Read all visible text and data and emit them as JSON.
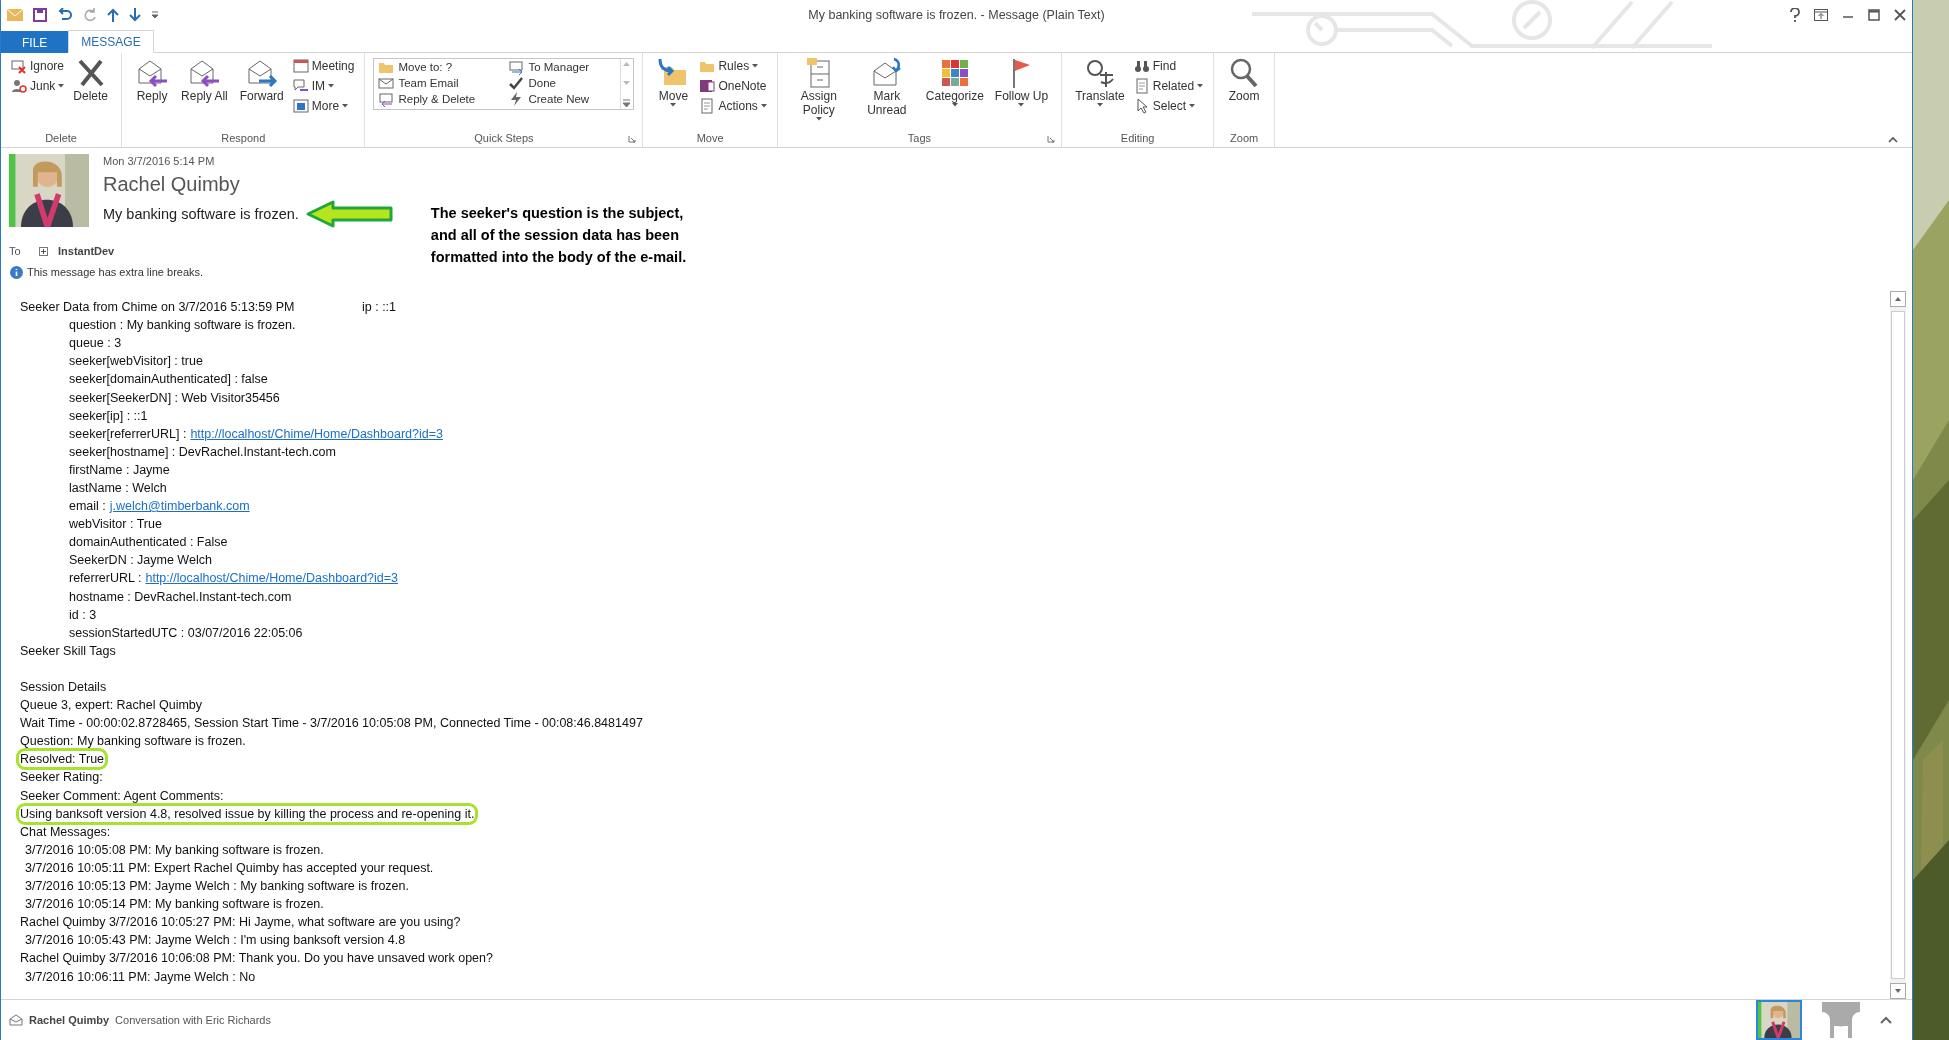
{
  "window": {
    "title": "My banking software is frozen. - Message (Plain Text)"
  },
  "ribbon_tabs": [
    {
      "label": "FILE",
      "kind": "file",
      "selected": false
    },
    {
      "label": "MESSAGE",
      "kind": "tab",
      "selected": true
    }
  ],
  "ribbon_groups": [
    {
      "label": "Delete",
      "launcher": false,
      "columns": [
        {
          "kind": "stack",
          "items": [
            {
              "label": "Ignore",
              "dropdown": false
            },
            {
              "label": "Junk",
              "dropdown": true
            }
          ]
        },
        {
          "kind": "large",
          "label": "Delete",
          "dropdown": false
        }
      ]
    },
    {
      "label": "Respond",
      "launcher": false,
      "columns": [
        {
          "kind": "large",
          "label": "Reply",
          "dropdown": false
        },
        {
          "kind": "large",
          "label": "Reply All",
          "dropdown": false
        },
        {
          "kind": "large",
          "label": "Forward",
          "dropdown": false
        },
        {
          "kind": "stack",
          "items": [
            {
              "label": "Meeting",
              "dropdown": false
            },
            {
              "label": "IM",
              "dropdown": true
            },
            {
              "label": "More",
              "dropdown": true
            }
          ]
        }
      ]
    },
    {
      "label": "Quick Steps",
      "launcher": true,
      "columns": [
        {
          "kind": "gallery",
          "items": [
            {
              "label": "Move to: ?"
            },
            {
              "label": "Team Email"
            },
            {
              "label": "Reply & Delete"
            },
            {
              "label": "To Manager"
            },
            {
              "label": "Done"
            },
            {
              "label": "Create New"
            }
          ]
        }
      ]
    },
    {
      "label": "Move",
      "launcher": false,
      "columns": [
        {
          "kind": "large",
          "label": "Move",
          "dropdown": true
        },
        {
          "kind": "stack",
          "items": [
            {
              "label": "Rules",
              "dropdown": true
            },
            {
              "label": "OneNote",
              "dropdown": false
            },
            {
              "label": "Actions",
              "dropdown": true
            }
          ]
        }
      ]
    },
    {
      "label": "Tags",
      "launcher": true,
      "columns": [
        {
          "kind": "large",
          "label": "Assign Policy",
          "dropdown": true
        },
        {
          "kind": "large",
          "label": "Mark Unread",
          "dropdown": false
        },
        {
          "kind": "large",
          "label": "Categorize",
          "dropdown": true
        },
        {
          "kind": "large",
          "label": "Follow Up",
          "dropdown": true
        }
      ]
    },
    {
      "label": "Editing",
      "launcher": false,
      "columns": [
        {
          "kind": "large",
          "label": "Translate",
          "dropdown": true
        },
        {
          "kind": "stack",
          "items": [
            {
              "label": "Find",
              "dropdown": false
            },
            {
              "label": "Related",
              "dropdown": true
            },
            {
              "label": "Select",
              "dropdown": true
            }
          ]
        }
      ]
    },
    {
      "label": "Zoom",
      "launcher": false,
      "columns": [
        {
          "kind": "large",
          "label": "Zoom",
          "dropdown": false
        }
      ]
    }
  ],
  "header": {
    "date": "Mon 3/7/2016 5:14 PM",
    "sender": "Rachel Quimby",
    "subject": "My banking software is frozen.",
    "to_label": "To",
    "recipient": "InstantDev",
    "info": "This message has extra line breaks."
  },
  "annotation": {
    "lines": [
      "The seeker's question is the subject,",
      "and all of the session data has been",
      "formatted into the body of the e-mail."
    ]
  },
  "body": [
    {
      "kind": "line",
      "text": "Seeker Data from Chime on 3/7/2016 5:13:59 PM",
      "aside": "ip : ::1",
      "highlighted": false
    },
    {
      "kind": "field",
      "text": "question : My banking software is frozen.",
      "highlighted": false
    },
    {
      "kind": "field",
      "text": "queue : 3",
      "highlighted": false
    },
    {
      "kind": "field",
      "text": "seeker[webVisitor] : true",
      "highlighted": false
    },
    {
      "kind": "field",
      "text": "seeker[domainAuthenticated] : false",
      "highlighted": false
    },
    {
      "kind": "field",
      "text": "seeker[SeekerDN] : Web Visitor35456",
      "highlighted": false
    },
    {
      "kind": "field",
      "text": "seeker[ip] : ::1",
      "highlighted": false
    },
    {
      "kind": "field",
      "text": "seeker[referrerURL] :",
      "link": "http://localhost/Chime/Home/Dashboard?id=3",
      "highlighted": false
    },
    {
      "kind": "field",
      "text": "seeker[hostname] : DevRachel.Instant-tech.com",
      "highlighted": false
    },
    {
      "kind": "field",
      "text": "firstName : Jayme",
      "highlighted": false
    },
    {
      "kind": "field",
      "text": "lastName : Welch",
      "highlighted": false
    },
    {
      "kind": "field",
      "text": "email :",
      "link": "j.welch@timberbank.com",
      "highlighted": false
    },
    {
      "kind": "field",
      "text": "webVisitor : True",
      "highlighted": false
    },
    {
      "kind": "field",
      "text": "domainAuthenticated : False",
      "highlighted": false
    },
    {
      "kind": "field",
      "text": "SeekerDN : Jayme Welch",
      "highlighted": false
    },
    {
      "kind": "field",
      "text": "referrerURL :",
      "link": "http://localhost/Chime/Home/Dashboard?id=3",
      "highlighted": false
    },
    {
      "kind": "field",
      "text": "hostname : DevRachel.Instant-tech.com",
      "highlighted": false
    },
    {
      "kind": "field",
      "text": "id : 3",
      "highlighted": false
    },
    {
      "kind": "field",
      "text": "sessionStartedUTC : 03/07/2016 22:05:06",
      "highlighted": false
    },
    {
      "kind": "line",
      "text": "Seeker Skill Tags",
      "highlighted": false
    },
    {
      "kind": "blank"
    },
    {
      "kind": "line",
      "text": "Session Details",
      "highlighted": false
    },
    {
      "kind": "line",
      "text": "Queue 3, expert: Rachel Quimby",
      "highlighted": false
    },
    {
      "kind": "line",
      "text": "Wait Time - 00:00:02.8728465, Session Start Time - 3/7/2016 10:05:08 PM, Connected Time - 00:08:46.8481497",
      "highlighted": false
    },
    {
      "kind": "line",
      "text": "Question: My banking software is frozen.",
      "highlighted": false
    },
    {
      "kind": "line",
      "text": "Resolved: True",
      "highlighted": true
    },
    {
      "kind": "line",
      "text": "Seeker Rating:",
      "highlighted": false
    },
    {
      "kind": "line",
      "text": "Seeker Comment: Agent Comments:",
      "highlighted": false
    },
    {
      "kind": "line",
      "text": "Using banksoft version 4.8, resolved issue by killing the process and re-opening it.",
      "highlighted": true
    },
    {
      "kind": "line",
      "text": "Chat Messages:",
      "highlighted": false
    },
    {
      "kind": "chat",
      "text": "3/7/2016 10:05:08 PM: My banking software is frozen.",
      "highlighted": false
    },
    {
      "kind": "chat",
      "text": "3/7/2016 10:05:11 PM: Expert Rachel Quimby has accepted your request.",
      "highlighted": false
    },
    {
      "kind": "chat",
      "text": "3/7/2016 10:05:13 PM: Jayme Welch : My banking software is frozen.",
      "highlighted": false
    },
    {
      "kind": "chat",
      "text": "3/7/2016 10:05:14 PM: My banking software is frozen.",
      "highlighted": false
    },
    {
      "kind": "line",
      "text": "Rachel Quimby 3/7/2016 10:05:27 PM: Hi Jayme, what software are you using?",
      "highlighted": false
    },
    {
      "kind": "chat",
      "text": "3/7/2016 10:05:43 PM: Jayme Welch : I'm using banksoft version 4.8",
      "highlighted": false
    },
    {
      "kind": "line",
      "text": "Rachel Quimby 3/7/2016 10:06:08 PM: Thank you. Do you have unsaved work open?",
      "highlighted": false
    },
    {
      "kind": "chat",
      "text": "3/7/2016 10:06:11 PM: Jayme Welch : No",
      "highlighted": false
    }
  ],
  "status_bar": {
    "sender": "Rachel Quimby",
    "text": "Conversation with Eric Richards",
    "avatar_selected": true
  }
}
